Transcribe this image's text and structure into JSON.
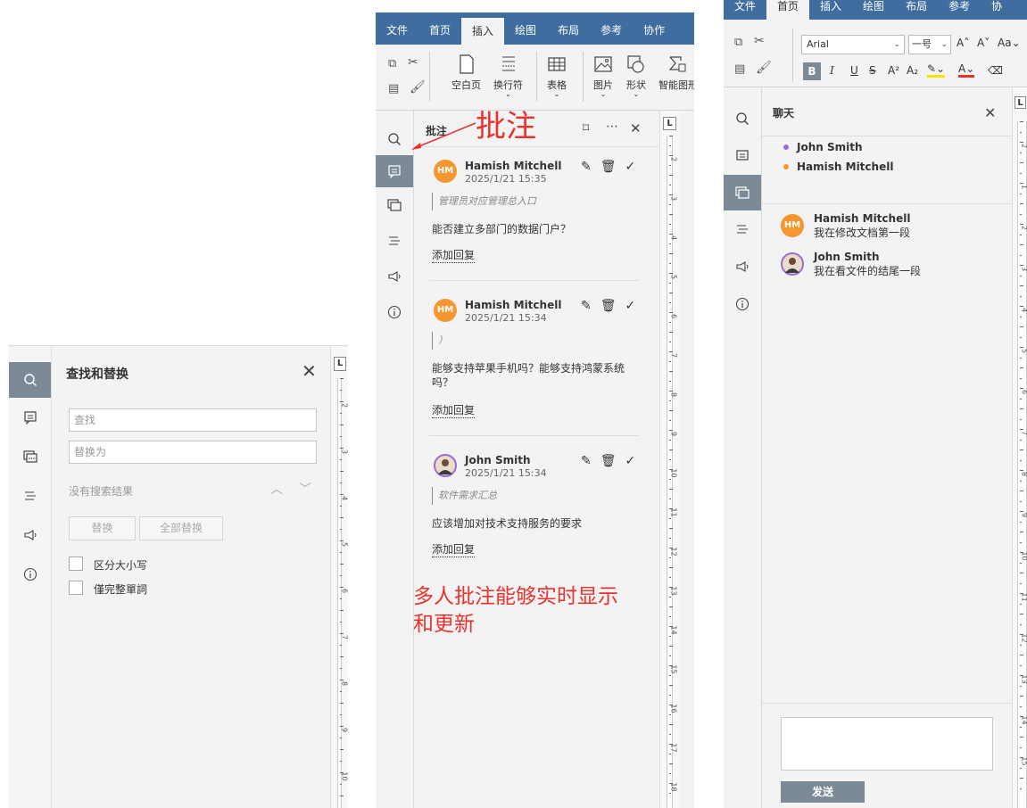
{
  "panel_find": {
    "title": "查找和替换",
    "find_placeholder": "查找",
    "replace_placeholder": "替换为",
    "status": "没有搜索结果",
    "replace_button": "替换",
    "replace_all_button": "全部替换",
    "option_case": "区分大小写",
    "option_whole_word": "僅完整單詞",
    "ruler_labels": [
      "2",
      "3",
      "4",
      "5",
      "6",
      "7",
      "8",
      "9",
      "10"
    ]
  },
  "panel_comments": {
    "tabs": [
      "文件",
      "首页",
      "插入",
      "绘图",
      "布局",
      "参考",
      "协作"
    ],
    "active_tab": "插入",
    "toolbar": {
      "blank_page": "空白页",
      "line_break": "换行符",
      "table": "表格",
      "picture": "图片",
      "shape": "形状",
      "smart_art": "智能图形"
    },
    "title": "批注",
    "annotation_label": "批注",
    "annotation_note_line1": "多人批注能够实时显示",
    "annotation_note_line2": "和更新",
    "annotation_color": "#e8322d",
    "comments": [
      {
        "initials": "HM",
        "author": "Hamish Mitchell",
        "time": "2025/1/21 15:35",
        "quote": "管理员对应管理总入口",
        "text": "能否建立多部门的数据门户？",
        "reply": "添加回复"
      },
      {
        "initials": "HM",
        "author": "Hamish Mitchell",
        "time": "2025/1/21 15:34",
        "quote": "）",
        "text": "能够支持苹果手机吗？能够支持鸿蒙系统吗？",
        "reply": "添加回复"
      },
      {
        "initials": "",
        "author": "John Smith",
        "time": "2025/1/21 15:34",
        "quote": "软件需求汇总",
        "text": "应该增加对技术支持服务的要求",
        "reply": "添加回复"
      }
    ],
    "avatar_color": "#f5962f",
    "ruler_labels": [
      "2",
      "3",
      "4",
      "5",
      "6",
      "7",
      "8",
      "9",
      "10",
      "11",
      "12",
      "13",
      "14",
      "15",
      "16",
      "17",
      "18"
    ]
  },
  "panel_chat": {
    "tabs": [
      "文件",
      "首页",
      "插入",
      "绘图",
      "布局",
      "参考",
      "协"
    ],
    "active_tab": "首页",
    "font_name": "Arial",
    "font_size": "一号",
    "title": "聊天",
    "participants": [
      {
        "name": "John Smith",
        "color": "#9b6cd6"
      },
      {
        "name": "Hamish Mitchell",
        "color": "#f5962f"
      }
    ],
    "messages": [
      {
        "initials": "HM",
        "author": "Hamish Mitchell",
        "text": "我在修改文档第一段"
      },
      {
        "initials": "",
        "author": "John Smith",
        "text": "我在看文件的结尾一段"
      }
    ],
    "send_button": "发送",
    "ruler_labels": [
      "2",
      "1",
      "2",
      "3",
      "4",
      "5",
      "6",
      "7",
      "8",
      "9",
      "10",
      "11",
      "12",
      "13",
      "14",
      "15"
    ]
  }
}
